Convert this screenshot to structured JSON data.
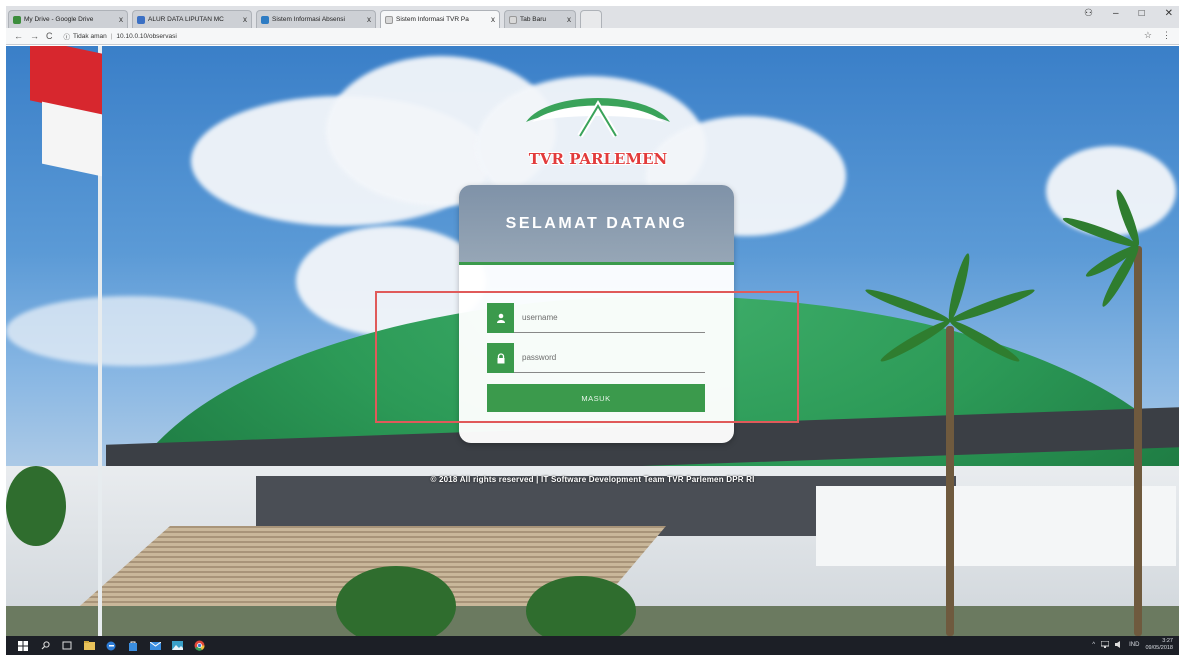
{
  "browser": {
    "tabs": [
      {
        "title": "My Drive - Google Drive",
        "favicon_color": "#3c8d3c",
        "active": false
      },
      {
        "title": "ALUR DATA LIPUTAN MC",
        "favicon_color": "#3b70c4",
        "active": false
      },
      {
        "title": "Sistem Informasi Absensi",
        "favicon_color": "#2e7cc4",
        "active": false
      },
      {
        "title": "Sistem Informasi TVR Pa",
        "favicon_color": "#d9d9d9",
        "active": true
      },
      {
        "title": "Tab Baru",
        "favicon_color": "#d9d9d9",
        "active": false
      }
    ],
    "close_glyph": "x",
    "window_controls": {
      "profile": "⚇",
      "minimize": "–",
      "maximize": "□",
      "close": "✕"
    },
    "nav": {
      "back": "←",
      "forward": "→",
      "reload": "C"
    },
    "address": {
      "security_icon": "ⓘ",
      "security_text": "Tidak aman",
      "url": "10.10.0.10/observasi"
    },
    "right_icons": {
      "bookmark": "☆",
      "menu": "⋮"
    }
  },
  "logo": {
    "text": "TVR PARLEMEN",
    "colors": {
      "green": "#3aa35a",
      "white": "#ffffff",
      "text": "#e23b3b"
    }
  },
  "login": {
    "title": "SELAMAT DATANG",
    "username_placeholder": "username",
    "password_placeholder": "password",
    "submit_label": "MASUK",
    "icons": {
      "username": "user-icon",
      "password": "lock-icon"
    },
    "accent": "#3b9a4c"
  },
  "annotation": {
    "color": "#e05a5a"
  },
  "footer": {
    "text": "© 2018 All rights reserved | IT Software Development Team TVR Parlemen DPR RI"
  },
  "taskbar": {
    "items": [
      "windows-start-icon",
      "search-icon",
      "task-view-icon",
      "file-explorer-icon",
      "edge-icon",
      "store-icon",
      "mail-icon",
      "photos-icon",
      "chrome-icon"
    ],
    "tray_lang": "IND",
    "clock_time": "3:27",
    "clock_date": "09/05/2018"
  }
}
